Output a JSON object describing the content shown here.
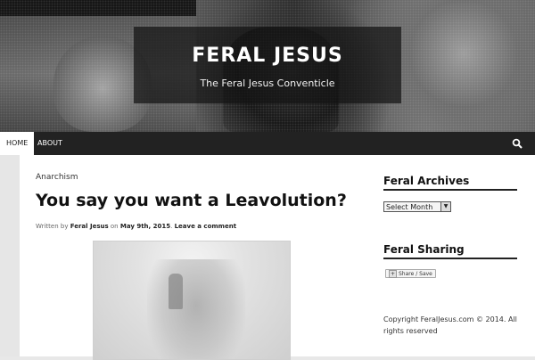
{
  "header": {
    "site_title": "FERAL JESUS",
    "tagline": "The Feral Jesus Conventicle"
  },
  "nav": {
    "items": [
      "HOME",
      "ABOUT"
    ],
    "search_icon": "search-icon"
  },
  "post": {
    "category": "Anarchism",
    "title": "You say you want a Leavolution?",
    "byline": {
      "written_by_label": "Written by",
      "author": "Feral Jesus",
      "on_label": "on",
      "date": "May 9th, 2015",
      "separator": ".",
      "comment_link": "Leave a comment"
    }
  },
  "sidebar": {
    "archives_title": "Feral Archives",
    "archives_select_value": "Select Month",
    "sharing_title": "Feral Sharing",
    "share_button_label": "Share / Save",
    "copyright": "Copyright FeralJesus.com © 2014. All rights reserved"
  },
  "colors": {
    "nav_bg": "#222222",
    "active_nav_bg": "#ffffff",
    "title_box_bg": "#141414"
  }
}
